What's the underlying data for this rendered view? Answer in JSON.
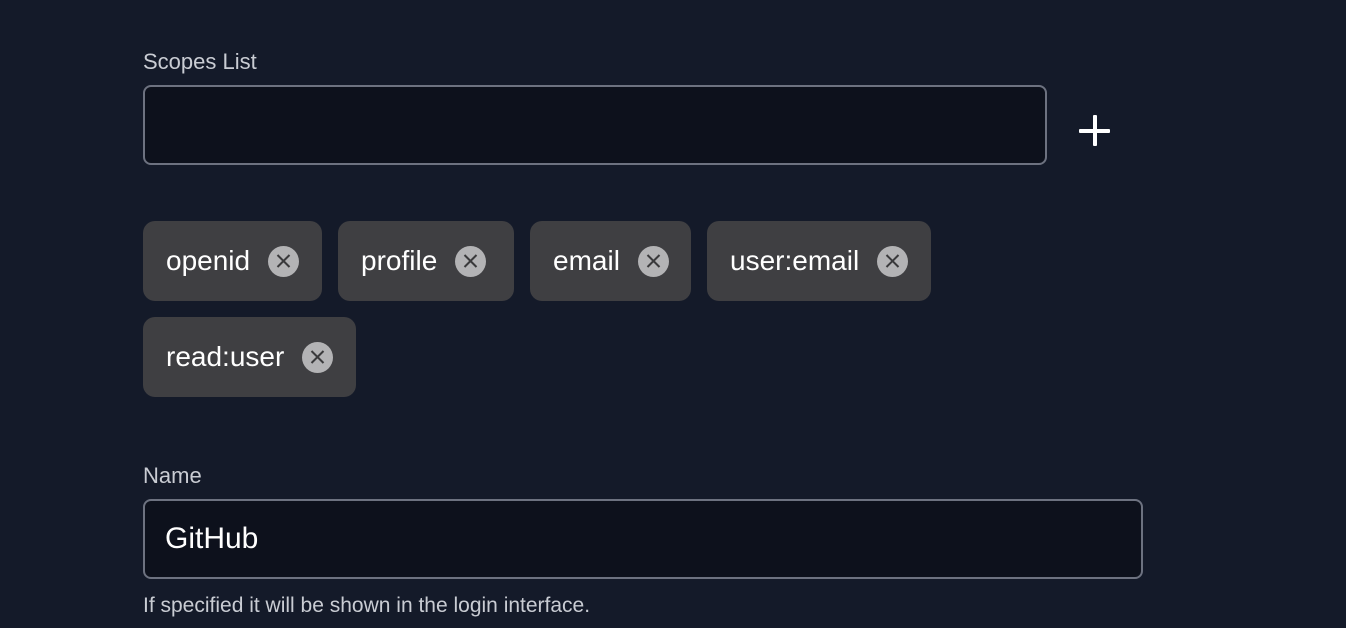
{
  "scopes": {
    "label": "Scopes List",
    "input_value": "",
    "input_placeholder": "",
    "add_icon": "plus-icon",
    "remove_icon": "close-circle-icon",
    "chips": [
      {
        "label": "openid"
      },
      {
        "label": "profile"
      },
      {
        "label": "email"
      },
      {
        "label": "user:email"
      },
      {
        "label": "read:user"
      }
    ]
  },
  "name": {
    "label": "Name",
    "value": "GitHub",
    "help": "If specified it will be shown in the login interface."
  },
  "colors": {
    "background": "#141a29",
    "input_background": "#0d111c",
    "input_border": "#6d7280",
    "chip_background": "#3f3f42",
    "chip_remove": "#b3b3b5",
    "label_text": "#c9ccd3",
    "value_text": "#ffffff"
  }
}
